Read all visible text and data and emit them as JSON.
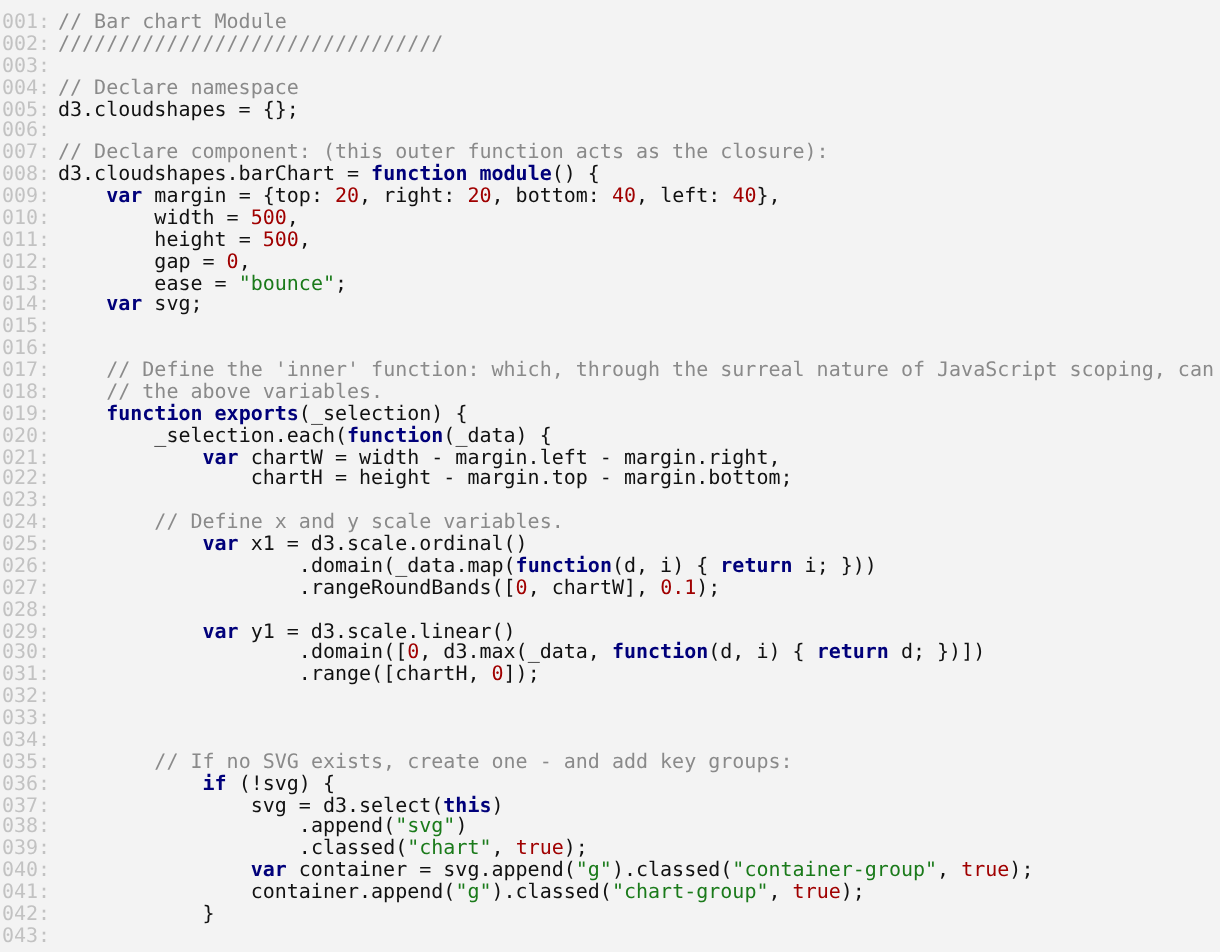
{
  "editor": {
    "lines": [
      {
        "number": "001:",
        "tokens": [
          {
            "kind": "comment",
            "text": "// Bar chart Module"
          }
        ]
      },
      {
        "number": "002:",
        "tokens": [
          {
            "kind": "comment",
            "text": "////////////////////////////////"
          }
        ]
      },
      {
        "number": "003:"
      },
      {
        "number": "004:",
        "tokens": [
          {
            "kind": "comment",
            "text": "// Declare namespace"
          }
        ]
      },
      {
        "number": "005:",
        "tokens": [
          {
            "kind": "plain",
            "text": "d3.cloudshapes = {};"
          }
        ]
      },
      {
        "number": "006:"
      },
      {
        "number": "007:",
        "tokens": [
          {
            "kind": "comment",
            "text": "// Declare component: (this outer function acts as the closure):"
          }
        ]
      },
      {
        "number": "008:",
        "tokens": [
          {
            "kind": "plain",
            "text": "d3.cloudshapes.barChart = "
          },
          {
            "kind": "keyword",
            "text": "function module"
          },
          {
            "kind": "plain",
            "text": "() {"
          }
        ]
      },
      {
        "number": "009:",
        "tokens": [
          {
            "kind": "keyword",
            "text": "    var"
          },
          {
            "kind": "plain",
            "text": " margin = {top: "
          },
          {
            "kind": "number",
            "text": "20"
          },
          {
            "kind": "plain",
            "text": ", right: "
          },
          {
            "kind": "number",
            "text": "20"
          },
          {
            "kind": "plain",
            "text": ", bottom: "
          },
          {
            "kind": "number",
            "text": "40"
          },
          {
            "kind": "plain",
            "text": ", left: "
          },
          {
            "kind": "number",
            "text": "40"
          },
          {
            "kind": "plain",
            "text": "},"
          }
        ]
      },
      {
        "number": "010:",
        "tokens": [
          {
            "kind": "plain",
            "text": "        width = "
          },
          {
            "kind": "number",
            "text": "500"
          },
          {
            "kind": "plain",
            "text": ","
          }
        ]
      },
      {
        "number": "011:",
        "tokens": [
          {
            "kind": "plain",
            "text": "        height = "
          },
          {
            "kind": "number",
            "text": "500"
          },
          {
            "kind": "plain",
            "text": ","
          }
        ]
      },
      {
        "number": "012:",
        "tokens": [
          {
            "kind": "plain",
            "text": "        gap = "
          },
          {
            "kind": "number",
            "text": "0"
          },
          {
            "kind": "plain",
            "text": ","
          }
        ]
      },
      {
        "number": "013:",
        "tokens": [
          {
            "kind": "plain",
            "text": "        ease = "
          },
          {
            "kind": "string",
            "text": "\"bounce\""
          },
          {
            "kind": "plain",
            "text": ";"
          }
        ]
      },
      {
        "number": "014:",
        "tokens": [
          {
            "kind": "keyword",
            "text": "    var"
          },
          {
            "kind": "plain",
            "text": " svg;"
          }
        ]
      },
      {
        "number": "015:"
      },
      {
        "number": "016:"
      },
      {
        "number": "017:",
        "tokens": [
          {
            "kind": "comment",
            "text": "    // Define the 'inner' function: which, through the surreal nature of JavaScript scoping, can"
          }
        ]
      },
      {
        "number": "018:",
        "tokens": [
          {
            "kind": "comment",
            "text": "    // the above variables."
          }
        ]
      },
      {
        "number": "019:",
        "tokens": [
          {
            "kind": "keyword",
            "text": "    function exports"
          },
          {
            "kind": "plain",
            "text": "(_selection) {"
          }
        ]
      },
      {
        "number": "020:",
        "tokens": [
          {
            "kind": "plain",
            "text": "        _selection.each("
          },
          {
            "kind": "keyword",
            "text": "function"
          },
          {
            "kind": "plain",
            "text": "(_data) {"
          }
        ]
      },
      {
        "number": "021:",
        "tokens": [
          {
            "kind": "keyword",
            "text": "            var"
          },
          {
            "kind": "plain",
            "text": " chartW = width - margin.left - margin.right,"
          }
        ]
      },
      {
        "number": "022:",
        "tokens": [
          {
            "kind": "plain",
            "text": "                chartH = height - margin.top - margin.bottom;"
          }
        ]
      },
      {
        "number": "023:"
      },
      {
        "number": "024:",
        "tokens": [
          {
            "kind": "comment",
            "text": "        // Define x and y scale variables."
          }
        ]
      },
      {
        "number": "025:",
        "tokens": [
          {
            "kind": "keyword",
            "text": "            var"
          },
          {
            "kind": "plain",
            "text": " x1 = d3.scale.ordinal()"
          }
        ]
      },
      {
        "number": "026:",
        "tokens": [
          {
            "kind": "plain",
            "text": "                    .domain(_data.map("
          },
          {
            "kind": "keyword",
            "text": "function"
          },
          {
            "kind": "plain",
            "text": "(d, i) { "
          },
          {
            "kind": "keyword",
            "text": "return"
          },
          {
            "kind": "plain",
            "text": " i; }))"
          }
        ]
      },
      {
        "number": "027:",
        "tokens": [
          {
            "kind": "plain",
            "text": "                    .rangeRoundBands(["
          },
          {
            "kind": "number",
            "text": "0"
          },
          {
            "kind": "plain",
            "text": ", chartW], "
          },
          {
            "kind": "number",
            "text": "0.1"
          },
          {
            "kind": "plain",
            "text": ");"
          }
        ]
      },
      {
        "number": "028:"
      },
      {
        "number": "029:",
        "tokens": [
          {
            "kind": "keyword",
            "text": "            var"
          },
          {
            "kind": "plain",
            "text": " y1 = d3.scale.linear()"
          }
        ]
      },
      {
        "number": "030:",
        "tokens": [
          {
            "kind": "plain",
            "text": "                    .domain(["
          },
          {
            "kind": "number",
            "text": "0"
          },
          {
            "kind": "plain",
            "text": ", d3.max(_data, "
          },
          {
            "kind": "keyword",
            "text": "function"
          },
          {
            "kind": "plain",
            "text": "(d, i) { "
          },
          {
            "kind": "keyword",
            "text": "return"
          },
          {
            "kind": "plain",
            "text": " d; })])"
          }
        ]
      },
      {
        "number": "031:",
        "tokens": [
          {
            "kind": "plain",
            "text": "                    .range([chartH, "
          },
          {
            "kind": "number",
            "text": "0"
          },
          {
            "kind": "plain",
            "text": "]);"
          }
        ]
      },
      {
        "number": "032:"
      },
      {
        "number": "033:"
      },
      {
        "number": "034:"
      },
      {
        "number": "035:",
        "tokens": [
          {
            "kind": "comment",
            "text": "        // If no SVG exists, create one - and add key groups:"
          }
        ]
      },
      {
        "number": "036:",
        "tokens": [
          {
            "kind": "keyword",
            "text": "            if"
          },
          {
            "kind": "plain",
            "text": " (!svg) {"
          }
        ]
      },
      {
        "number": "037:",
        "tokens": [
          {
            "kind": "plain",
            "text": "                svg = d3.select("
          },
          {
            "kind": "keyword",
            "text": "this"
          },
          {
            "kind": "plain",
            "text": ")"
          }
        ]
      },
      {
        "number": "038:",
        "tokens": [
          {
            "kind": "plain",
            "text": "                    .append("
          },
          {
            "kind": "string",
            "text": "\"svg\""
          },
          {
            "kind": "plain",
            "text": ")"
          }
        ]
      },
      {
        "number": "039:",
        "tokens": [
          {
            "kind": "plain",
            "text": "                    .classed("
          },
          {
            "kind": "string",
            "text": "\"chart\""
          },
          {
            "kind": "plain",
            "text": ", "
          },
          {
            "kind": "literal",
            "text": "true"
          },
          {
            "kind": "plain",
            "text": ");"
          }
        ]
      },
      {
        "number": "040:",
        "tokens": [
          {
            "kind": "keyword",
            "text": "                var"
          },
          {
            "kind": "plain",
            "text": " container = svg.append("
          },
          {
            "kind": "string",
            "text": "\"g\""
          },
          {
            "kind": "plain",
            "text": ").classed("
          },
          {
            "kind": "string",
            "text": "\"container-group\""
          },
          {
            "kind": "plain",
            "text": ", "
          },
          {
            "kind": "literal",
            "text": "true"
          },
          {
            "kind": "plain",
            "text": ");"
          }
        ]
      },
      {
        "number": "041:",
        "tokens": [
          {
            "kind": "plain",
            "text": "                container.append("
          },
          {
            "kind": "string",
            "text": "\"g\""
          },
          {
            "kind": "plain",
            "text": ").classed("
          },
          {
            "kind": "string",
            "text": "\"chart-group\""
          },
          {
            "kind": "plain",
            "text": ", "
          },
          {
            "kind": "literal",
            "text": "true"
          },
          {
            "kind": "plain",
            "text": ");"
          }
        ]
      },
      {
        "number": "042:",
        "tokens": [
          {
            "kind": "plain",
            "text": "            }"
          }
        ]
      },
      {
        "number": "043:"
      }
    ]
  }
}
